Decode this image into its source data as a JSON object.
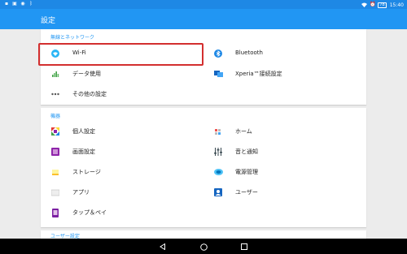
{
  "status_bar": {
    "time": "15:40",
    "battery": "78"
  },
  "toolbar": {
    "title": "設定"
  },
  "sections": {
    "wireless": {
      "title": "無線とネットワーク",
      "items": {
        "wifi": "Wi-Fi",
        "bluetooth": "Bluetooth",
        "data_usage": "データ使用",
        "xperia_connect": "Xperia™接続設定",
        "more": "その他の設定"
      }
    },
    "device": {
      "title": "機器",
      "items": {
        "personalize": "個人設定",
        "home": "ホーム",
        "sound": "画面設定",
        "sound_notify": "音と通知",
        "storage": "ストレージ",
        "power": "電源管理",
        "apps": "アプリ",
        "users": "ユーザー",
        "tap_pay": "タップ＆ペイ"
      }
    },
    "user": {
      "title": "ユーザー設定"
    }
  },
  "colors": {
    "accent": "#2196f3",
    "status_bar": "#1e88e5",
    "highlight": "#d32f2f"
  }
}
